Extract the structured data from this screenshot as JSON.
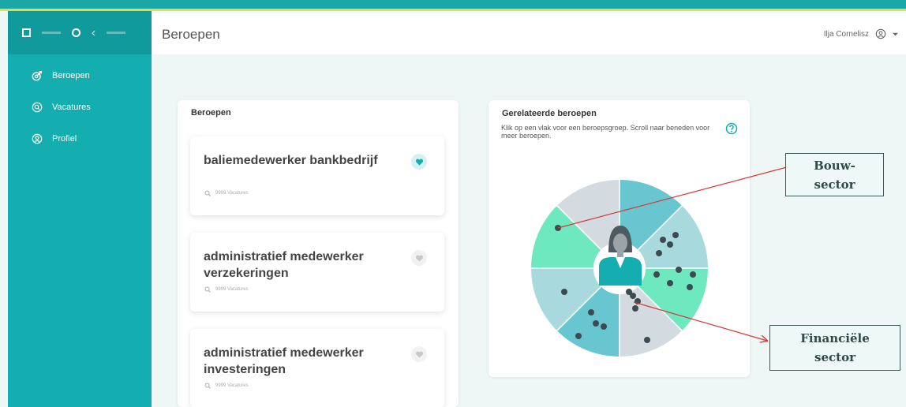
{
  "sidebar": {
    "items": [
      {
        "label": "Beroepen",
        "icon": "target-icon"
      },
      {
        "label": "Vacatures",
        "icon": "search-icon"
      },
      {
        "label": "Profiel",
        "icon": "user-icon"
      }
    ]
  },
  "header": {
    "title": "Beroepen",
    "user_name": "Ilja Cornelisz"
  },
  "left_card": {
    "title": "Beroepen",
    "jobs": [
      {
        "name": "baliemedewerker bankbedrijf",
        "vacancies": "9999 Vacatures",
        "favorite": true
      },
      {
        "name": "administratief medewerker verzekeringen",
        "vacancies": "9999 Vacatures",
        "favorite": false
      },
      {
        "name": "administratief medewerker investeringen",
        "vacancies": "9999 Vacatures",
        "favorite": false
      }
    ]
  },
  "right_card": {
    "title": "Gerelateerde beroepen",
    "hint": "Klik op een vlak voor een beroepsgroep. Scroll naar beneden voor meer beroepen."
  },
  "callouts": {
    "bouw": [
      "Bouw-",
      "sector"
    ],
    "financieel": [
      "Financiële",
      "sector"
    ]
  },
  "colors": {
    "teal": "#14aeb0",
    "mint": "#6ee8bf",
    "light_teal": "#a8d9dc",
    "mid_teal": "#67c6cf",
    "gray_blue": "#d3dbe1",
    "arrow_red": "#d43a3a"
  }
}
